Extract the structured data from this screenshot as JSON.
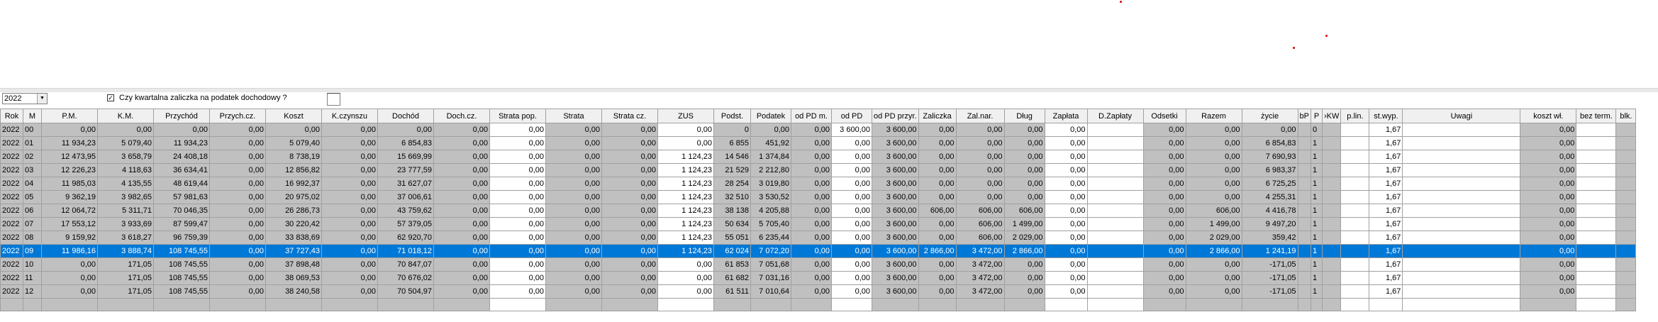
{
  "year_select": {
    "value": "2022"
  },
  "quarterly_advance": {
    "label": "Czy kwartalna zaliczka na podatek dochodowy ?",
    "checked": true
  },
  "columns": [
    "Rok",
    "M",
    "P.M.",
    "K.M.",
    "Przychód",
    "Przych.cz.",
    "Koszt",
    "K.czynszu",
    "Dochód",
    "Doch.cz.",
    "Strata pop.",
    "Strata",
    "Strata cz.",
    "ZUS",
    "Podst.",
    "Podatek",
    "od PD m.",
    "od PD",
    "od PD przyr.",
    "Zaliczka",
    "Zal.nar.",
    "Dług",
    "Zapłata",
    "D.Zapłaty",
    "Odsetki",
    "Razem",
    "życie",
    "bP",
    "P",
    "›KW",
    "p.lin.",
    "st.wyp.",
    "Uwagi",
    "koszt wł.",
    "bez term.",
    "blk."
  ],
  "rows": [
    [
      "2022",
      "00",
      "0,00",
      "0,00",
      "0,00",
      "0,00",
      "0,00",
      "0,00",
      "0,00",
      "0,00",
      "0,00",
      "0,00",
      "0,00",
      "0,00",
      "0",
      "0,00",
      "0,00",
      "3 600,00",
      "3 600,00",
      "0,00",
      "0,00",
      "0,00",
      "0,00",
      "",
      "0,00",
      "0,00",
      "0,00",
      "",
      "0",
      "",
      "",
      "1,67",
      "",
      "0,00",
      "",
      ""
    ],
    [
      "2022",
      "01",
      "11 934,23",
      "5 079,40",
      "11 934,23",
      "0,00",
      "5 079,40",
      "0,00",
      "6 854,83",
      "0,00",
      "0,00",
      "0,00",
      "0,00",
      "0,00",
      "6 855",
      "451,92",
      "0,00",
      "0,00",
      "3 600,00",
      "0,00",
      "0,00",
      "0,00",
      "0,00",
      "",
      "0,00",
      "0,00",
      "6 854,83",
      "",
      "1",
      "",
      "",
      "1,67",
      "",
      "0,00",
      "",
      ""
    ],
    [
      "2022",
      "02",
      "12 473,95",
      "3 658,79",
      "24 408,18",
      "0,00",
      "8 738,19",
      "0,00",
      "15 669,99",
      "0,00",
      "0,00",
      "0,00",
      "0,00",
      "1 124,23",
      "14 546",
      "1 374,84",
      "0,00",
      "0,00",
      "3 600,00",
      "0,00",
      "0,00",
      "0,00",
      "0,00",
      "",
      "0,00",
      "0,00",
      "7 690,93",
      "",
      "1",
      "",
      "",
      "1,67",
      "",
      "0,00",
      "",
      ""
    ],
    [
      "2022",
      "03",
      "12 226,23",
      "4 118,63",
      "36 634,41",
      "0,00",
      "12 856,82",
      "0,00",
      "23 777,59",
      "0,00",
      "0,00",
      "0,00",
      "0,00",
      "1 124,23",
      "21 529",
      "2 212,80",
      "0,00",
      "0,00",
      "3 600,00",
      "0,00",
      "0,00",
      "0,00",
      "0,00",
      "",
      "0,00",
      "0,00",
      "6 983,37",
      "",
      "1",
      "",
      "",
      "1,67",
      "",
      "0,00",
      "",
      ""
    ],
    [
      "2022",
      "04",
      "11 985,03",
      "4 135,55",
      "48 619,44",
      "0,00",
      "16 992,37",
      "0,00",
      "31 627,07",
      "0,00",
      "0,00",
      "0,00",
      "0,00",
      "1 124,23",
      "28 254",
      "3 019,80",
      "0,00",
      "0,00",
      "3 600,00",
      "0,00",
      "0,00",
      "0,00",
      "0,00",
      "",
      "0,00",
      "0,00",
      "6 725,25",
      "",
      "1",
      "",
      "",
      "1,67",
      "",
      "0,00",
      "",
      ""
    ],
    [
      "2022",
      "05",
      "9 362,19",
      "3 982,65",
      "57 981,63",
      "0,00",
      "20 975,02",
      "0,00",
      "37 006,61",
      "0,00",
      "0,00",
      "0,00",
      "0,00",
      "1 124,23",
      "32 510",
      "3 530,52",
      "0,00",
      "0,00",
      "3 600,00",
      "0,00",
      "0,00",
      "0,00",
      "0,00",
      "",
      "0,00",
      "0,00",
      "4 255,31",
      "",
      "1",
      "",
      "",
      "1,67",
      "",
      "0,00",
      "",
      ""
    ],
    [
      "2022",
      "06",
      "12 064,72",
      "5 311,71",
      "70 046,35",
      "0,00",
      "26 286,73",
      "0,00",
      "43 759,62",
      "0,00",
      "0,00",
      "0,00",
      "0,00",
      "1 124,23",
      "38 138",
      "4 205,88",
      "0,00",
      "0,00",
      "3 600,00",
      "606,00",
      "606,00",
      "606,00",
      "0,00",
      "",
      "0,00",
      "606,00",
      "4 416,78",
      "",
      "1",
      "",
      "",
      "1,67",
      "",
      "0,00",
      "",
      ""
    ],
    [
      "2022",
      "07",
      "17 553,12",
      "3 933,69",
      "87 599,47",
      "0,00",
      "30 220,42",
      "0,00",
      "57 379,05",
      "0,00",
      "0,00",
      "0,00",
      "0,00",
      "1 124,23",
      "50 634",
      "5 705,40",
      "0,00",
      "0,00",
      "3 600,00",
      "0,00",
      "606,00",
      "1 499,00",
      "0,00",
      "",
      "0,00",
      "1 499,00",
      "9 497,20",
      "",
      "1",
      "",
      "",
      "1,67",
      "",
      "0,00",
      "",
      ""
    ],
    [
      "2022",
      "08",
      "9 159,92",
      "3 618,27",
      "96 759,39",
      "0,00",
      "33 838,69",
      "0,00",
      "62 920,70",
      "0,00",
      "0,00",
      "0,00",
      "0,00",
      "1 124,23",
      "55 051",
      "6 235,44",
      "0,00",
      "0,00",
      "3 600,00",
      "0,00",
      "606,00",
      "2 029,00",
      "0,00",
      "",
      "0,00",
      "2 029,00",
      "359,42",
      "",
      "1",
      "",
      "",
      "1,67",
      "",
      "0,00",
      "",
      ""
    ],
    [
      "2022",
      "09",
      "11 986,16",
      "3 888,74",
      "108 745,55",
      "0,00",
      "37 727,43",
      "0,00",
      "71 018,12",
      "0,00",
      "0,00",
      "0,00",
      "0,00",
      "1 124,23",
      "62 024",
      "7 072,20",
      "0,00",
      "0,00",
      "3 600,00",
      "2 866,00",
      "3 472,00",
      "2 866,00",
      "0,00",
      "",
      "0,00",
      "2 866,00",
      "1 241,19",
      "",
      "1",
      "",
      "",
      "1,67",
      "",
      "0,00",
      "",
      ""
    ],
    [
      "2022",
      "10",
      "0,00",
      "171,05",
      "108 745,55",
      "0,00",
      "37 898,48",
      "0,00",
      "70 847,07",
      "0,00",
      "0,00",
      "0,00",
      "0,00",
      "0,00",
      "61 853",
      "7 051,68",
      "0,00",
      "0,00",
      "3 600,00",
      "0,00",
      "3 472,00",
      "0,00",
      "0,00",
      "",
      "0,00",
      "0,00",
      "-171,05",
      "",
      "1",
      "",
      "",
      "1,67",
      "",
      "0,00",
      "",
      ""
    ],
    [
      "2022",
      "11",
      "0,00",
      "171,05",
      "108 745,55",
      "0,00",
      "38 069,53",
      "0,00",
      "70 676,02",
      "0,00",
      "0,00",
      "0,00",
      "0,00",
      "0,00",
      "61 682",
      "7 031,16",
      "0,00",
      "0,00",
      "3 600,00",
      "0,00",
      "3 472,00",
      "0,00",
      "0,00",
      "",
      "0,00",
      "0,00",
      "-171,05",
      "",
      "1",
      "",
      "",
      "1,67",
      "",
      "0,00",
      "",
      ""
    ],
    [
      "2022",
      "12",
      "0,00",
      "171,05",
      "108 745,55",
      "0,00",
      "38 240,58",
      "0,00",
      "70 504,97",
      "0,00",
      "0,00",
      "0,00",
      "0,00",
      "0,00",
      "61 511",
      "7 010,64",
      "0,00",
      "0,00",
      "3 600,00",
      "0,00",
      "3 472,00",
      "0,00",
      "0,00",
      "",
      "0,00",
      "0,00",
      "-171,05",
      "",
      "1",
      "",
      "",
      "1,67",
      "",
      "0,00",
      "",
      ""
    ]
  ]
}
